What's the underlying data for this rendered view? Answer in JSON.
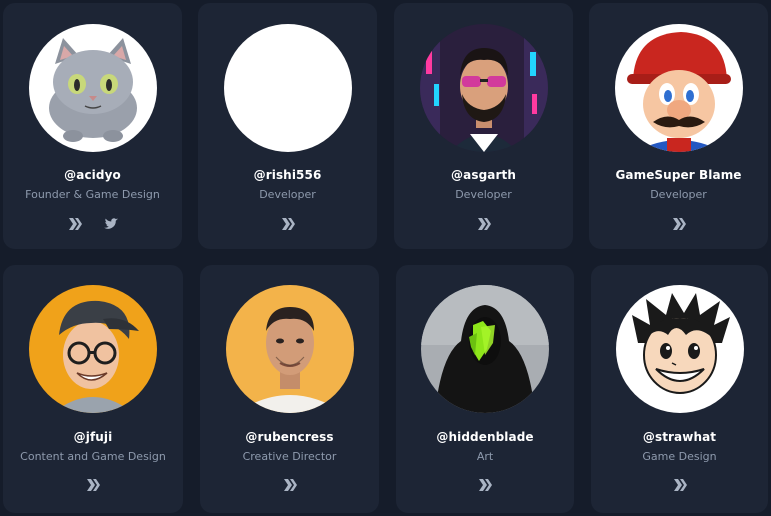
{
  "members": [
    {
      "handle": "@acidyo",
      "role": "Founder & Game Design",
      "avatar": "gray-cat-avatar",
      "socials": [
        "hive-icon",
        "twitter-icon"
      ]
    },
    {
      "handle": "@rishi556",
      "role": "Developer",
      "avatar": "blank-white-avatar",
      "socials": [
        "hive-icon"
      ]
    },
    {
      "handle": "@asgarth",
      "role": "Developer",
      "avatar": "bearded-man-sunglasses-avatar",
      "socials": [
        "hive-icon"
      ]
    },
    {
      "handle": "GameSuper Blame",
      "role": "Developer",
      "avatar": "mario-avatar",
      "socials": [
        "hive-icon"
      ]
    },
    {
      "handle": "@jfuji",
      "role": "Content and Game Design",
      "avatar": "man-glasses-cap-avatar",
      "socials": [
        "hive-icon"
      ]
    },
    {
      "handle": "@rubencress",
      "role": "Creative Director",
      "avatar": "man-portrait-avatar",
      "socials": [
        "hive-icon"
      ]
    },
    {
      "handle": "@hiddenblade",
      "role": "Art",
      "avatar": "hooded-figure-avatar",
      "socials": [
        "hive-icon"
      ]
    },
    {
      "handle": "@strawhat",
      "role": "Game Design",
      "avatar": "anime-boy-avatar",
      "socials": [
        "hive-icon"
      ]
    }
  ],
  "colors": {
    "background": "#151c2a",
    "card": "#1d2535",
    "name": "#ffffff",
    "role": "#8e9aad",
    "icon": "#aab4c4"
  }
}
